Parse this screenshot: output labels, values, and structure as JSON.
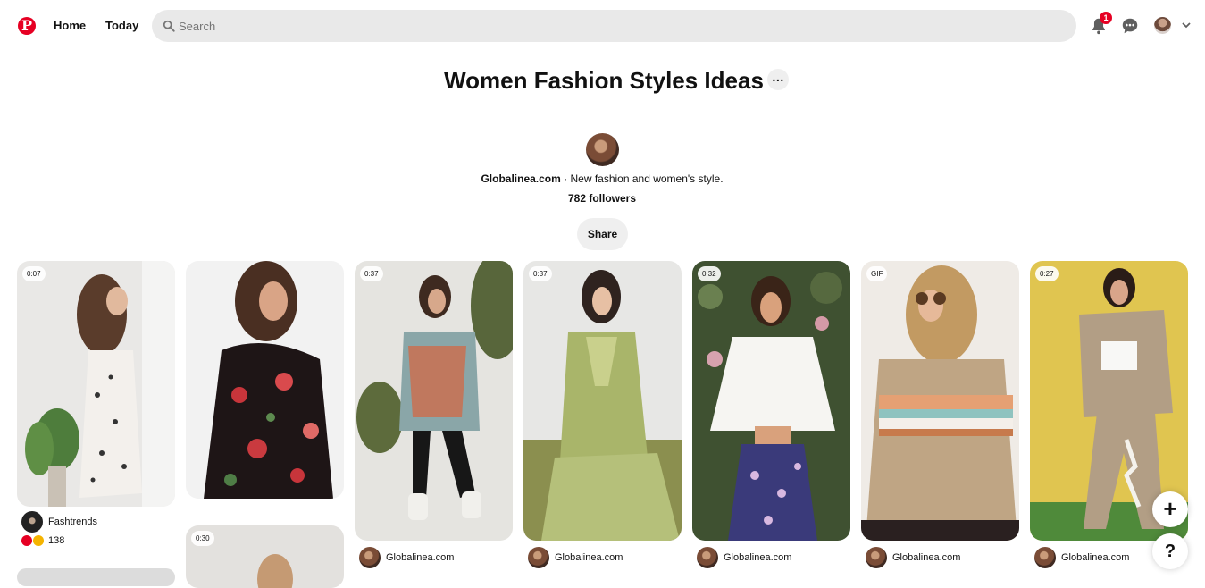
{
  "header": {
    "logo": "P",
    "nav": {
      "home": "Home",
      "today": "Today"
    },
    "search": {
      "placeholder": "Search"
    },
    "notifications_count": "1"
  },
  "board": {
    "title": "Women Fashion Styles Ideas",
    "more": "…",
    "owner": "Globalinea.com",
    "separator": " · ",
    "description": "New fashion and women's style.",
    "followers": "782 followers",
    "share": "Share"
  },
  "pins": [
    {
      "tag": "0:07",
      "author": "Fashtrends",
      "reactions_count": "138"
    },
    {
      "tag": "",
      "author": ""
    },
    {
      "tag": "0:37",
      "author": "Globalinea.com"
    },
    {
      "tag": "0:37",
      "author": "Globalinea.com"
    },
    {
      "tag": "0:32",
      "author": "Globalinea.com"
    },
    {
      "tag": "GIF",
      "author": "Globalinea.com"
    },
    {
      "tag": "0:27",
      "author": "Globalinea.com"
    },
    {
      "tag": "0:30",
      "author": ""
    }
  ],
  "fabs": {
    "add": "+",
    "help": "?"
  },
  "colors": {
    "brand": "#e60023",
    "search_bg": "#e9e9e9",
    "button_bg": "#efefef"
  }
}
